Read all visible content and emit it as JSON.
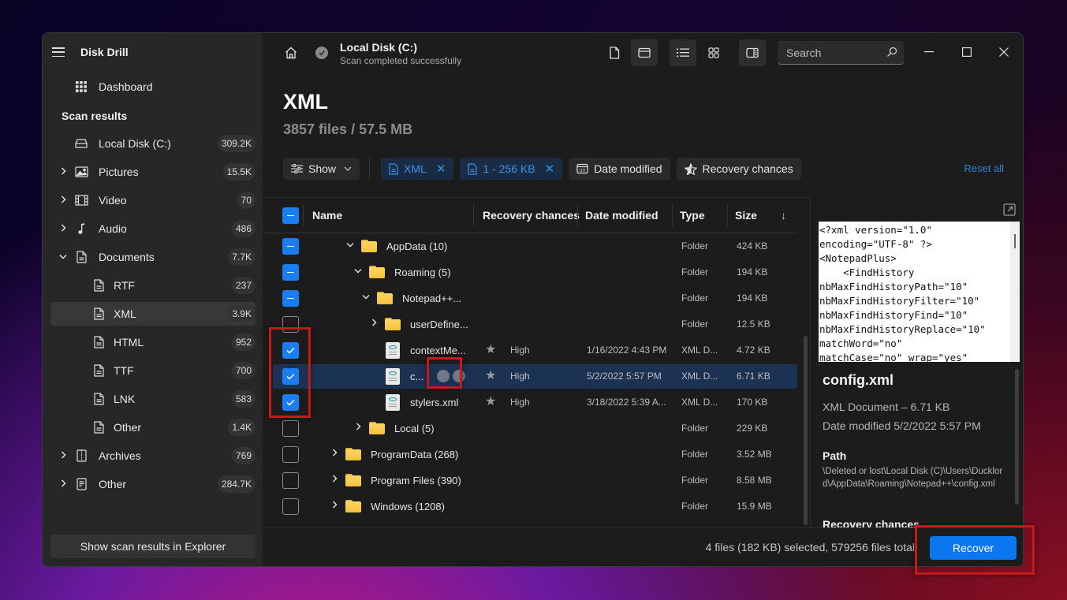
{
  "app": {
    "title": "Disk Drill"
  },
  "sidebar": {
    "dashboard_label": "Dashboard",
    "section_title": "Scan results",
    "items": [
      {
        "label": "Local Disk (C:)",
        "count": "309.2K",
        "icon": "drive-icon",
        "expand": "none"
      },
      {
        "label": "Pictures",
        "count": "15.5K",
        "icon": "image-icon",
        "expand": "collapsed"
      },
      {
        "label": "Video",
        "count": "70",
        "icon": "film-icon",
        "expand": "collapsed"
      },
      {
        "label": "Audio",
        "count": "486",
        "icon": "music-note-icon",
        "expand": "collapsed"
      },
      {
        "label": "Documents",
        "count": "7.7K",
        "icon": "document-icon",
        "expand": "expanded"
      },
      {
        "label": "RTF",
        "count": "237",
        "icon": "document-icon",
        "expand": "child"
      },
      {
        "label": "XML",
        "count": "3.9K",
        "icon": "document-icon",
        "expand": "child",
        "active": true
      },
      {
        "label": "HTML",
        "count": "952",
        "icon": "document-icon",
        "expand": "child"
      },
      {
        "label": "TTF",
        "count": "700",
        "icon": "document-icon",
        "expand": "child"
      },
      {
        "label": "LNK",
        "count": "583",
        "icon": "document-icon",
        "expand": "child"
      },
      {
        "label": "Other",
        "count": "1.4K",
        "icon": "document-icon",
        "expand": "child"
      },
      {
        "label": "Archives",
        "count": "769",
        "icon": "archive-icon",
        "expand": "collapsed"
      },
      {
        "label": "Other",
        "count": "284.7K",
        "icon": "file-list-icon",
        "expand": "collapsed"
      }
    ],
    "footer_button": "Show scan results in Explorer"
  },
  "header": {
    "disk_name": "Local Disk (C:)",
    "status": "Scan completed successfully",
    "search_placeholder": "Search"
  },
  "page": {
    "title": "XML",
    "subtitle": "3857 files / 57.5 MB"
  },
  "filters": {
    "show_label": "Show",
    "chips": [
      {
        "label": "XML",
        "active": true
      },
      {
        "label": "1 - 256 KB",
        "active": true
      }
    ],
    "date_modified": "Date modified",
    "recovery_chances": "Recovery chances",
    "reset_all": "Reset all"
  },
  "table": {
    "columns": {
      "name": "Name",
      "recovery": "Recovery chances",
      "date": "Date modified",
      "type": "Type",
      "size": "Size"
    },
    "sort_indicator": "↓",
    "rows": [
      {
        "name": "AppData (10)",
        "kind": "folder",
        "indent": 0,
        "expand": "expanded",
        "check": "mixed",
        "recovery": "",
        "date": "",
        "type": "Folder",
        "size": "424 KB"
      },
      {
        "name": "Roaming (5)",
        "kind": "folder",
        "indent": 1,
        "expand": "expanded",
        "check": "mixed",
        "recovery": "",
        "date": "",
        "type": "Folder",
        "size": "194 KB"
      },
      {
        "name": "Notepad++...",
        "kind": "folder",
        "indent": 2,
        "expand": "expanded",
        "check": "mixed",
        "recovery": "",
        "date": "",
        "type": "Folder",
        "size": "194 KB"
      },
      {
        "name": "userDefine...",
        "kind": "folder",
        "indent": 3,
        "expand": "collapsed",
        "check": "none",
        "recovery": "",
        "date": "",
        "type": "Folder",
        "size": "12.5 KB"
      },
      {
        "name": "contextMe...",
        "kind": "xml",
        "indent": 3,
        "expand": "none",
        "check": "checked",
        "recovery": "High",
        "date": "1/16/2022 4:43 PM",
        "type": "XML D...",
        "size": "4.72 KB"
      },
      {
        "name": "c...",
        "kind": "xml",
        "indent": 3,
        "expand": "none",
        "check": "checked",
        "recovery": "High",
        "date": "5/2/2022 5:57 PM",
        "type": "XML D...",
        "size": "6.71 KB",
        "selected": true
      },
      {
        "name": "stylers.xml",
        "kind": "xml",
        "indent": 3,
        "expand": "none",
        "check": "checked",
        "recovery": "High",
        "date": "3/18/2022 5:39 A...",
        "type": "XML D...",
        "size": "170 KB"
      },
      {
        "name": "Local (5)",
        "kind": "folder",
        "indent": 1,
        "expand": "collapsed",
        "check": "none",
        "recovery": "",
        "date": "",
        "type": "Folder",
        "size": "229 KB"
      },
      {
        "name": "ProgramData (268)",
        "kind": "folder",
        "indent": -1,
        "expand": "collapsed",
        "check": "none",
        "recovery": "",
        "date": "",
        "type": "Folder",
        "size": "3.52 MB"
      },
      {
        "name": "Program Files (390)",
        "kind": "folder",
        "indent": -1,
        "expand": "collapsed",
        "check": "none",
        "recovery": "",
        "date": "",
        "type": "Folder",
        "size": "8.58 MB"
      },
      {
        "name": "Windows (1208)",
        "kind": "folder",
        "indent": -1,
        "expand": "collapsed",
        "check": "none",
        "recovery": "",
        "date": "",
        "type": "Folder",
        "size": "15.9 MB"
      }
    ]
  },
  "preview": {
    "code_lines": [
      "<?xml version=\"1.0\"",
      "encoding=\"UTF-8\" ?>",
      "<NotepadPlus>",
      "    <FindHistory",
      "nbMaxFindHistoryPath=\"10\"",
      "nbMaxFindHistoryFilter=\"10\"",
      "nbMaxFindHistoryFind=\"10\"",
      "nbMaxFindHistoryReplace=\"10\"",
      "matchWord=\"no\"",
      "matchCase=\"no\" wrap=\"yes\""
    ],
    "file_name": "config.xml",
    "file_desc": "XML Document – 6.71 KB",
    "date_modified": "Date modified 5/2/2022 5:57 PM",
    "path_heading": "Path",
    "path": "\\Deleted or lost\\Local Disk (C)\\Users\\Ducklord\\AppData\\Roaming\\Notepad++\\config.xml",
    "recovery_heading": "Recovery chances"
  },
  "footer": {
    "selection_info": "4 files (182 KB) selected, 579256 files total",
    "recover_label": "Recover"
  },
  "colors": {
    "accent": "#0a76f0",
    "selected_row": "#1c3252",
    "chip_active_text": "#3d8fe8",
    "highlight_box": "#c41a1a"
  }
}
